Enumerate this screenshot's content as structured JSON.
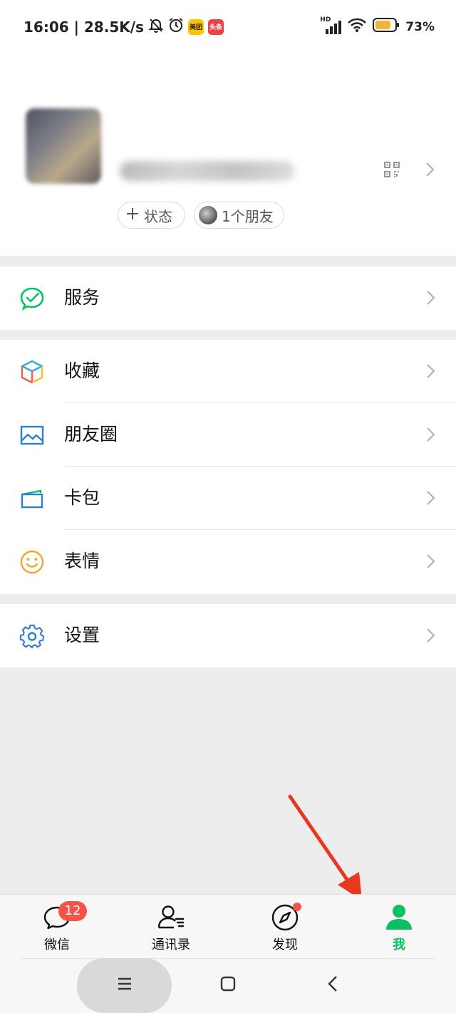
{
  "status_bar": {
    "time_speed": "16:06 | 28.5K/s",
    "meituan_label": "美团",
    "toutiao_label": "头条",
    "network_label": "HD",
    "battery": "73%"
  },
  "profile": {
    "status_button": "状态",
    "friends_button": "1个朋友"
  },
  "menu": {
    "services": "服务",
    "favorites": "收藏",
    "moments": "朋友圈",
    "cards": "卡包",
    "stickers": "表情",
    "settings": "设置"
  },
  "tabs": {
    "chats": "微信",
    "chats_badge": "12",
    "contacts": "通讯录",
    "discover": "发现",
    "me": "我"
  },
  "colors": {
    "accent": "#07c160",
    "badge": "#f55248",
    "annotation_arrow": "#e8361f"
  }
}
